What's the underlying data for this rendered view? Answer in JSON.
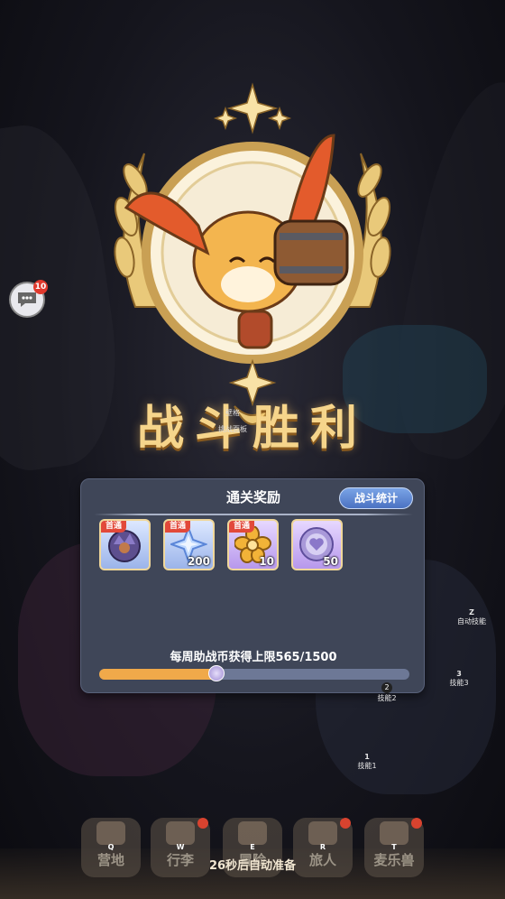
{
  "victory": {
    "title": "战斗胜利",
    "small_label_1": "壁格",
    "small_label_2": "挑战面板"
  },
  "chat": {
    "badge_count": "10",
    "icon": "chat-bubble-icon"
  },
  "reward_panel": {
    "title": "通关奖励",
    "stats_button": "战斗统计",
    "items": [
      {
        "tag": "首通",
        "count": "",
        "icon": "creature-egg-icon",
        "frame": "blue"
      },
      {
        "tag": "首通",
        "count": "200",
        "icon": "blue-crystal-icon",
        "frame": "blue"
      },
      {
        "tag": "首通",
        "count": "10",
        "icon": "gold-flower-icon",
        "frame": "purple"
      },
      {
        "tag": "",
        "count": "50",
        "icon": "purple-coin-icon",
        "frame": "purple"
      }
    ],
    "weekly_limit_text": "每周助战币获得上限565/1500",
    "progress_fraction": 0.377
  },
  "hints": {
    "auto_skill": {
      "key": "Z",
      "label": "自动技能"
    },
    "skill2": {
      "key": "2",
      "label": "技能2"
    },
    "skill3": {
      "key": "3",
      "label": "技能3"
    },
    "skill1": {
      "key": "1",
      "label": "技能1"
    }
  },
  "nav": [
    {
      "key": "Q",
      "label": "营地",
      "icon": "camp-icon",
      "dot": false
    },
    {
      "key": "W",
      "label": "行李",
      "icon": "luggage-icon",
      "dot": true
    },
    {
      "key": "E",
      "label": "冒险",
      "icon": "swords-icon",
      "dot": false
    },
    {
      "key": "R",
      "label": "旅人",
      "icon": "traveler-icon",
      "dot": true
    },
    {
      "key": "T",
      "label": "麦乐兽",
      "icon": "beast-icon",
      "dot": true
    }
  ],
  "countdown": "26秒后自动准备",
  "colors": {
    "gold": "#f6d58b",
    "panel": "#3f4658",
    "progress": "#f0a94a",
    "badge": "#e0392d"
  }
}
